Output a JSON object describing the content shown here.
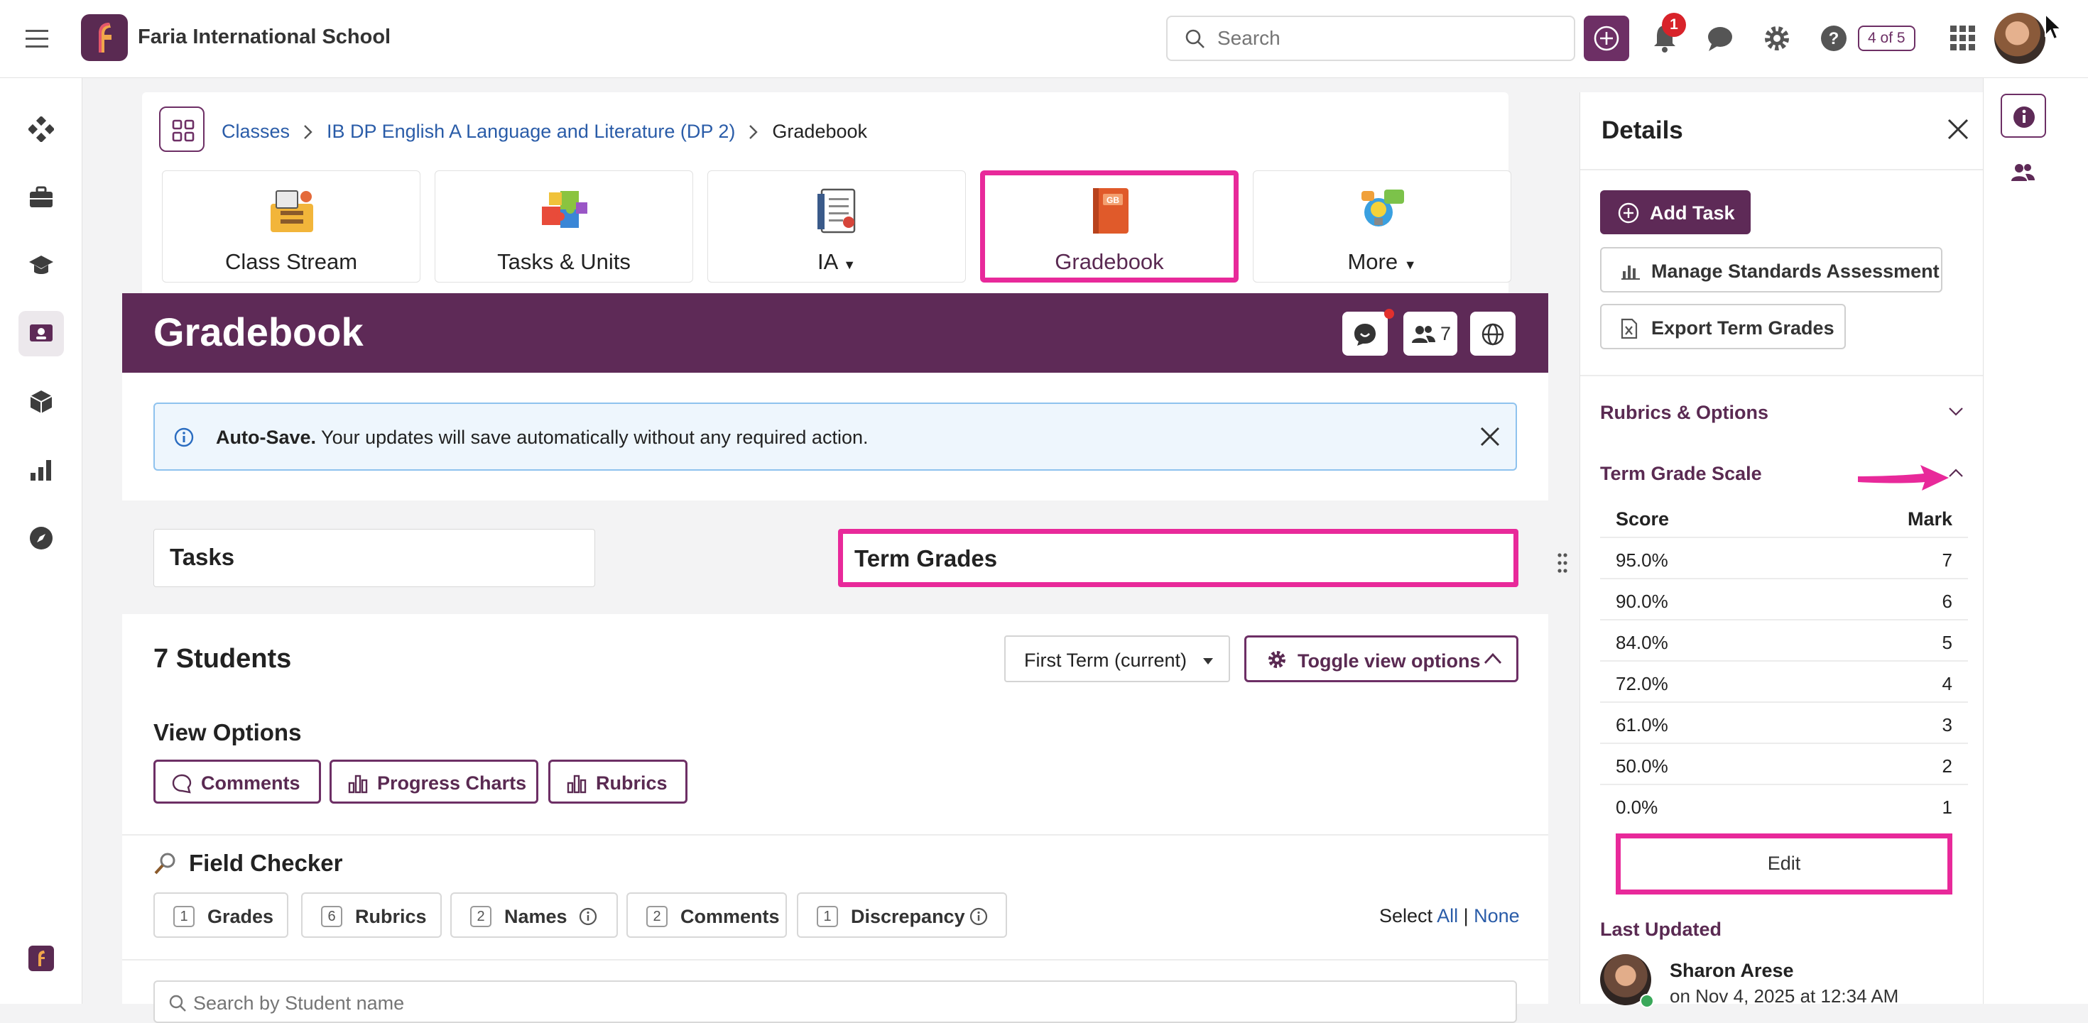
{
  "header": {
    "school_name": "Faria International School",
    "search_placeholder": "Search",
    "notification_count": "1",
    "page_counter": "4 of 5"
  },
  "breadcrumb": {
    "items": [
      "Classes",
      "IB DP English A Language and Literature (DP 2)"
    ],
    "current": "Gradebook"
  },
  "tiles": [
    {
      "label": "Class Stream",
      "icon": "class-stream-icon"
    },
    {
      "label": "Tasks & Units",
      "icon": "puzzle-icon"
    },
    {
      "label": "IA",
      "icon": "ia-document-icon",
      "dropdown": true
    },
    {
      "label": "Gradebook",
      "icon": "gradebook-book-icon",
      "selected": true
    },
    {
      "label": "More",
      "icon": "more-lightbulb-icon",
      "dropdown": true
    }
  ],
  "banner": {
    "title": "Gradebook",
    "member_count": "7"
  },
  "alert": {
    "bold": "Auto-Save.",
    "text": " Your updates will save automatically without any required action."
  },
  "tabs": {
    "tasks": "Tasks",
    "term_grades": "Term Grades",
    "selected": "term_grades"
  },
  "students": {
    "count_label": "7 Students",
    "term_select": "First Term (current)",
    "toggle_label": "Toggle view options"
  },
  "view_options": {
    "heading": "View Options",
    "buttons": [
      "Comments",
      "Progress Charts",
      "Rubrics"
    ]
  },
  "field_checker": {
    "heading": "Field Checker",
    "chips": [
      {
        "count": "1",
        "label": "Grades"
      },
      {
        "count": "6",
        "label": "Rubrics"
      },
      {
        "count": "2",
        "label": "Names"
      },
      {
        "count": "2",
        "label": "Comments"
      },
      {
        "count": "1",
        "label": "Discrepancy"
      }
    ],
    "select_label": "Select",
    "all": "All",
    "separator": "|",
    "none": "None"
  },
  "student_search_placeholder": "Search by Student name",
  "details": {
    "title": "Details",
    "add_task": "Add Task",
    "manage_standards": "Manage Standards Assessment",
    "export_term_grades": "Export Term Grades",
    "rubrics_options": "Rubrics & Options",
    "term_grade_scale": "Term Grade Scale",
    "scale_headers": {
      "score": "Score",
      "mark": "Mark"
    },
    "scale": [
      {
        "score": "95.0%",
        "mark": "7"
      },
      {
        "score": "90.0%",
        "mark": "6"
      },
      {
        "score": "84.0%",
        "mark": "5"
      },
      {
        "score": "72.0%",
        "mark": "4"
      },
      {
        "score": "61.0%",
        "mark": "3"
      },
      {
        "score": "50.0%",
        "mark": "2"
      },
      {
        "score": "0.0%",
        "mark": "1"
      }
    ],
    "edit": "Edit",
    "last_updated": "Last Updated",
    "updated_by": "Sharon Arese",
    "updated_on": "on Nov 4, 2025 at 12:34 AM"
  },
  "colors": {
    "brand": "#5e2a57",
    "highlight": "#e8299a",
    "link": "#2a5ca8"
  }
}
